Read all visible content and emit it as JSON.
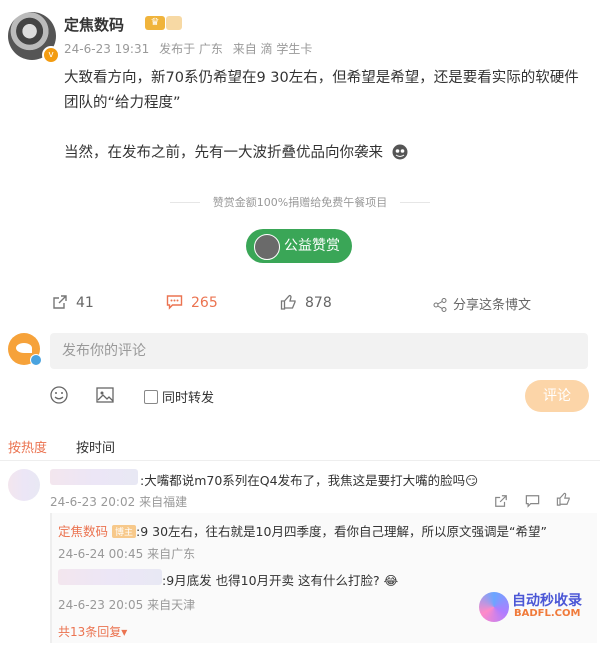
{
  "post": {
    "username": "定焦数码",
    "badge": "♛",
    "time": "24-6-23 19:31",
    "location": "发布于 广东",
    "source": "来自 滴 学生卡",
    "line1": "大致看方向，新70系仍希望在9 30左右，但希望是希望，还是要看实际的软硬件",
    "line2": "团队的“给力程度”",
    "line3": "当然，在发布之前，先有一大波折叠优品向你袭来"
  },
  "donate": {
    "text": "赞赏金额100%捐赠给免费午餐项目",
    "button": "公益赞赏"
  },
  "actions": {
    "share_count": "41",
    "comment_count": "265",
    "like_count": "878",
    "share_label": "分享这条博文"
  },
  "composer": {
    "placeholder": "发布你的评论",
    "repost_label": "同时转发",
    "submit_label": "评论"
  },
  "tabs": {
    "hot": "按热度",
    "time": "按时间"
  },
  "comments": [
    {
      "text": ":大嘴都说m70系列在Q4发布了，我焦这是要打大嘴的脸吗😏",
      "time": "24-6-23 20:02",
      "source": "来自福建",
      "replies": [
        {
          "name": "定焦数码",
          "tag": "博主",
          "text": ":9 30左右，往右就是10月四季度，看你自己理解，所以原文强调是“希望”",
          "time": "24-6-24 00:45",
          "source": "来自广东"
        },
        {
          "name": "",
          "text": ":9月底发 也得10月开卖  这有什么打脸? 😂",
          "time": "24-6-23 20:05",
          "source": "来自天津"
        }
      ],
      "more": "共13条回复▾"
    }
  ],
  "watermark": {
    "line1": "自动秒收录",
    "line2": "BADFL.COM"
  },
  "colors": {
    "accent": "#eb7350",
    "green": "#3aa657",
    "submit_disabled": "#fcd5a8"
  }
}
